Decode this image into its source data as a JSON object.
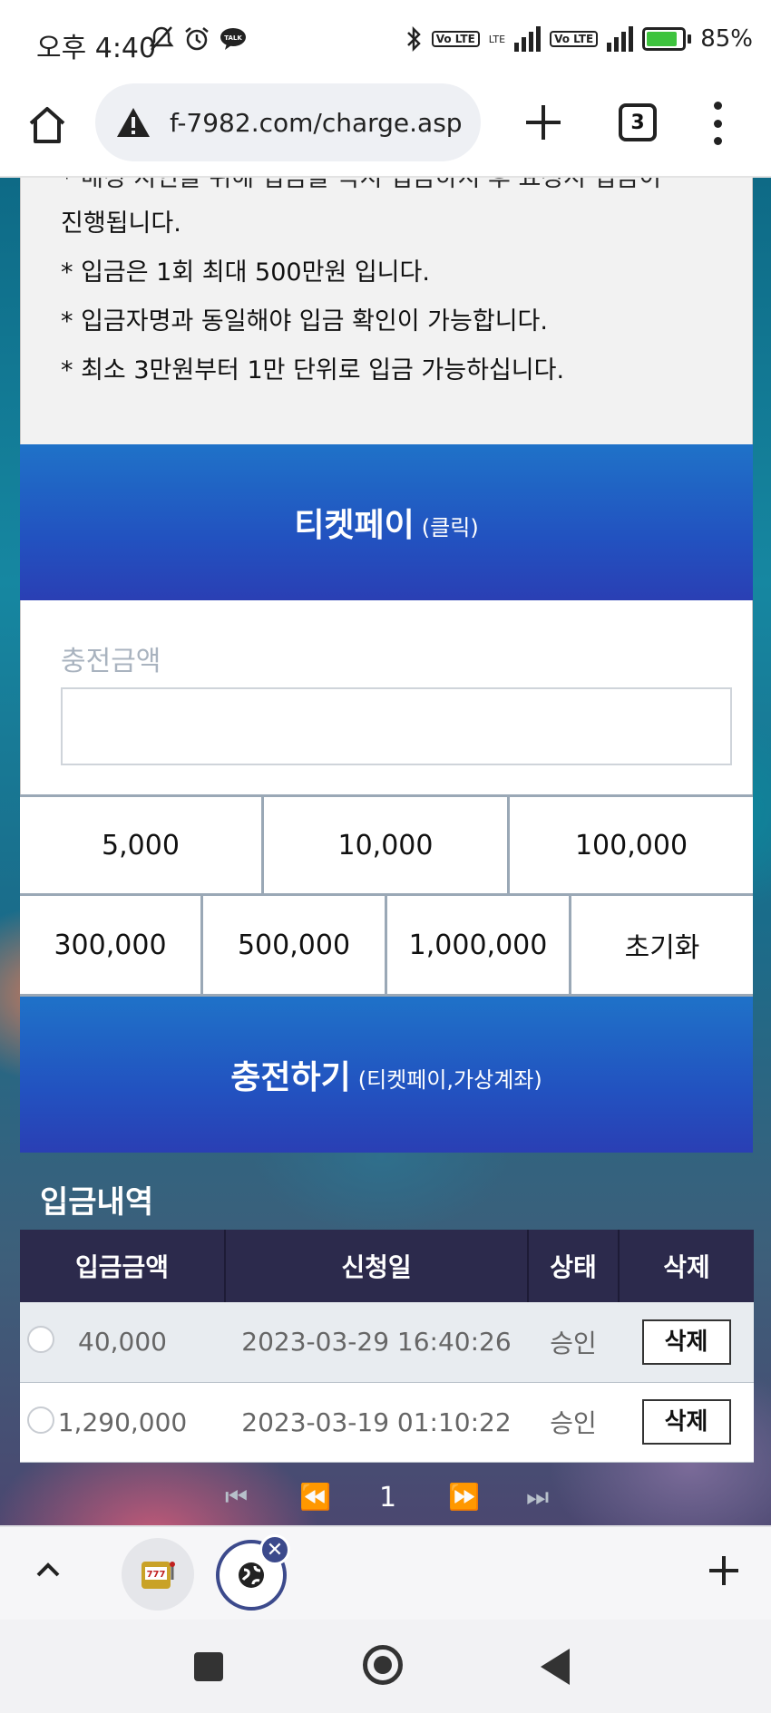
{
  "status_bar": {
    "time": "오후 4:40",
    "battery_percent": "85%",
    "battery_level": 0.85,
    "volte_label": "Vo LTE",
    "lte_label": "LTE",
    "icons": [
      "mute-bell-icon",
      "alarm-icon",
      "talk-icon",
      "bluetooth-icon",
      "signal-icon",
      "battery-icon"
    ]
  },
  "browser": {
    "url": "f-7982.com/charge.asp",
    "tab_count": "3"
  },
  "notice": {
    "cut_line": "* 매칭 지연을 위해 입금을 즉시 입금하시 후 요청시 입금이",
    "lines": [
      "진행됩니다.",
      "* 입금은 1회 최대 500만원 입니다.",
      "* 입금자명과 동일해야 입금 확인이 가능합니다.",
      "* 최소 3만원부터 1만 단위로 입금 가능하십니다."
    ]
  },
  "ticketpay": {
    "label": "티켓페이",
    "sub": "(클릭)"
  },
  "amount": {
    "label": "충전금액",
    "value": ""
  },
  "quick_amounts": {
    "row1": [
      "5,000",
      "10,000",
      "100,000"
    ],
    "row2": [
      "300,000",
      "500,000",
      "1,000,000",
      "초기화"
    ]
  },
  "charge": {
    "label": "충전하기",
    "sub": "(티켓페이,가상계좌)"
  },
  "history": {
    "title": "입금내역",
    "headers": [
      "입금금액",
      "신청일",
      "상태",
      "삭제"
    ],
    "rows": [
      {
        "amount": "40,000",
        "date": "2023-03-29 16:40:26",
        "status": "승인",
        "delete": "삭제"
      },
      {
        "amount": "1,290,000",
        "date": "2023-03-19 01:10:22",
        "status": "승인",
        "delete": "삭제"
      }
    ]
  },
  "pagination": {
    "first": "⏮",
    "prev": "⏪",
    "current": "1",
    "next": "⏩",
    "last": "⏭"
  },
  "bottom_bar": {
    "tab1_icon": "slot-machine-icon",
    "tab2_icon": "globe-icon"
  },
  "colors": {
    "button_blue": "#2252c0",
    "table_header": "#2c2a4c",
    "active_tab_ring": "#3c4a8c"
  }
}
